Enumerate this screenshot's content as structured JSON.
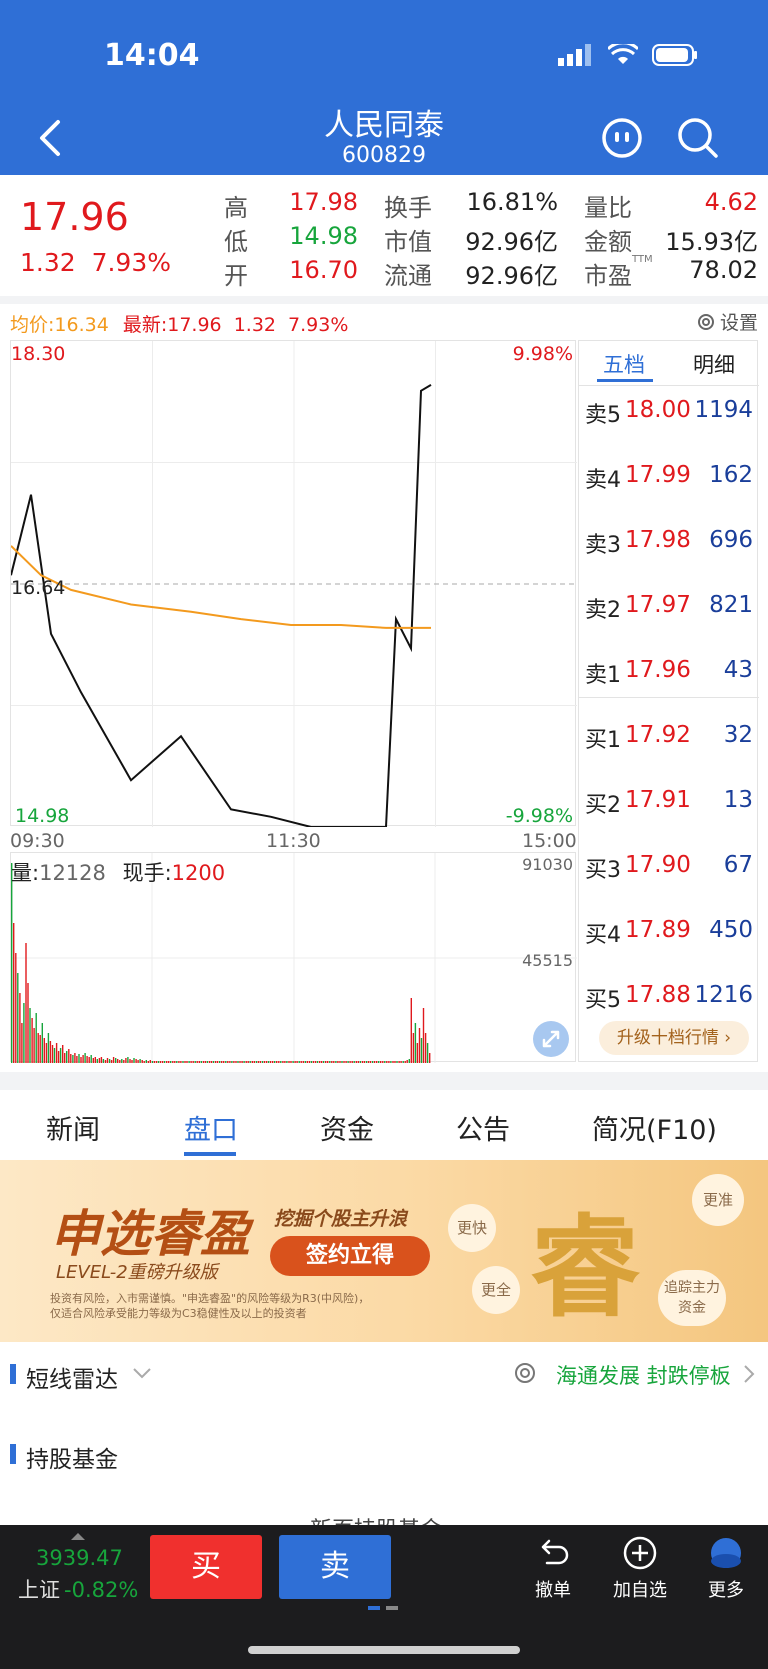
{
  "status_bar": {
    "time": "14:04"
  },
  "header": {
    "title": "人民同泰",
    "code": "600829"
  },
  "quote": {
    "price": "17.96",
    "change": "1.32",
    "change_pct": "7.93%",
    "stats": [
      {
        "label": "高",
        "value": "17.98",
        "color": "red"
      },
      {
        "label": "换手",
        "value": "16.81%",
        "color": "dark"
      },
      {
        "label": "量比",
        "value": "4.62",
        "color": "red"
      },
      {
        "label": "低",
        "value": "14.98",
        "color": "green"
      },
      {
        "label": "市值",
        "value": "92.96亿",
        "color": "dark"
      },
      {
        "label": "金额",
        "value": "15.93亿",
        "color": "dark"
      },
      {
        "label": "开",
        "value": "16.70",
        "color": "red"
      },
      {
        "label": "流通",
        "value": "92.96亿",
        "color": "dark"
      },
      {
        "label": "市盈",
        "value": "78.02",
        "color": "dark"
      }
    ],
    "ttm": "TTM"
  },
  "chart_info": {
    "avg_label": "均价:16.34",
    "latest_label": "最新:17.96",
    "latest_chg": "1.32",
    "latest_pct": "7.93%",
    "settings": "设置"
  },
  "intraday": {
    "y_high": "18.30",
    "y_mid": "16.64",
    "y_low": "14.98",
    "pct_high": "9.98%",
    "pct_low": "-9.98%",
    "t_start": "09:30",
    "t_mid": "11:30",
    "t_end": "15:00"
  },
  "volume": {
    "vol_label": "量:",
    "vol_value": "12128",
    "hand_label": "现手:",
    "hand_value": "1200",
    "ymax": "91030",
    "ymid": "45515"
  },
  "chart_data": {
    "type": "line",
    "title": "",
    "xlabel": "",
    "ylabel": "",
    "x": [
      "09:30",
      "11:30",
      "15:00"
    ],
    "ylim": [
      14.98,
      18.3
    ],
    "series": [
      {
        "name": "最新",
        "values": [
          16.7,
          17.25,
          16.3,
          15.9,
          15.3,
          15.6,
          15.1,
          15.05,
          14.98,
          14.98,
          14.98,
          16.4,
          16.2,
          17.96,
          18.0
        ]
      },
      {
        "name": "均价",
        "values": [
          16.9,
          16.7,
          16.6,
          16.5,
          16.45,
          16.4,
          16.36,
          16.36,
          16.34,
          16.34,
          16.34
        ]
      }
    ]
  },
  "order_book": {
    "tab_active": "五档",
    "tab_other": "明细",
    "asks": [
      {
        "label": "卖5",
        "price": "18.00",
        "vol": "1194"
      },
      {
        "label": "卖4",
        "price": "17.99",
        "vol": "162"
      },
      {
        "label": "卖3",
        "price": "17.98",
        "vol": "696"
      },
      {
        "label": "卖2",
        "price": "17.97",
        "vol": "821"
      },
      {
        "label": "卖1",
        "price": "17.96",
        "vol": "43"
      }
    ],
    "bids": [
      {
        "label": "买1",
        "price": "17.92",
        "vol": "32"
      },
      {
        "label": "买2",
        "price": "17.91",
        "vol": "13"
      },
      {
        "label": "买3",
        "price": "17.90",
        "vol": "67"
      },
      {
        "label": "买4",
        "price": "17.89",
        "vol": "450"
      },
      {
        "label": "买5",
        "price": "17.88",
        "vol": "1216"
      }
    ],
    "upgrade": "升级十档行情 ›"
  },
  "tabs": [
    "新闻",
    "盘口",
    "资金",
    "公告",
    "简况(F10)"
  ],
  "banner": {
    "brand": "申选睿盈",
    "sub": "LEVEL-2重磅升级版",
    "slogan": "挖掘个股主升浪",
    "cta": "签约立得",
    "disclaimer1": "投资有风险，入市需谨慎。\"申选睿盈\"的风险等级为R3(中风险)，",
    "disclaimer2": "仅适合风险承受能力等级为C3稳健性及以上的投资者",
    "char": "睿",
    "bubbles": [
      "更快",
      "更全",
      "更准",
      "追踪主力资金"
    ]
  },
  "sections": {
    "radar": "短线雷达",
    "radar_right": "海通发展 封跌停板",
    "fund": "持股基金",
    "partial": "新页持股基金"
  },
  "bottom_bar": {
    "index_value": "3939.47",
    "index_name": "上证",
    "index_pct": "-0.82%",
    "buy": "买",
    "sell": "卖",
    "nav": [
      "撤单",
      "加自选",
      "更多"
    ]
  }
}
